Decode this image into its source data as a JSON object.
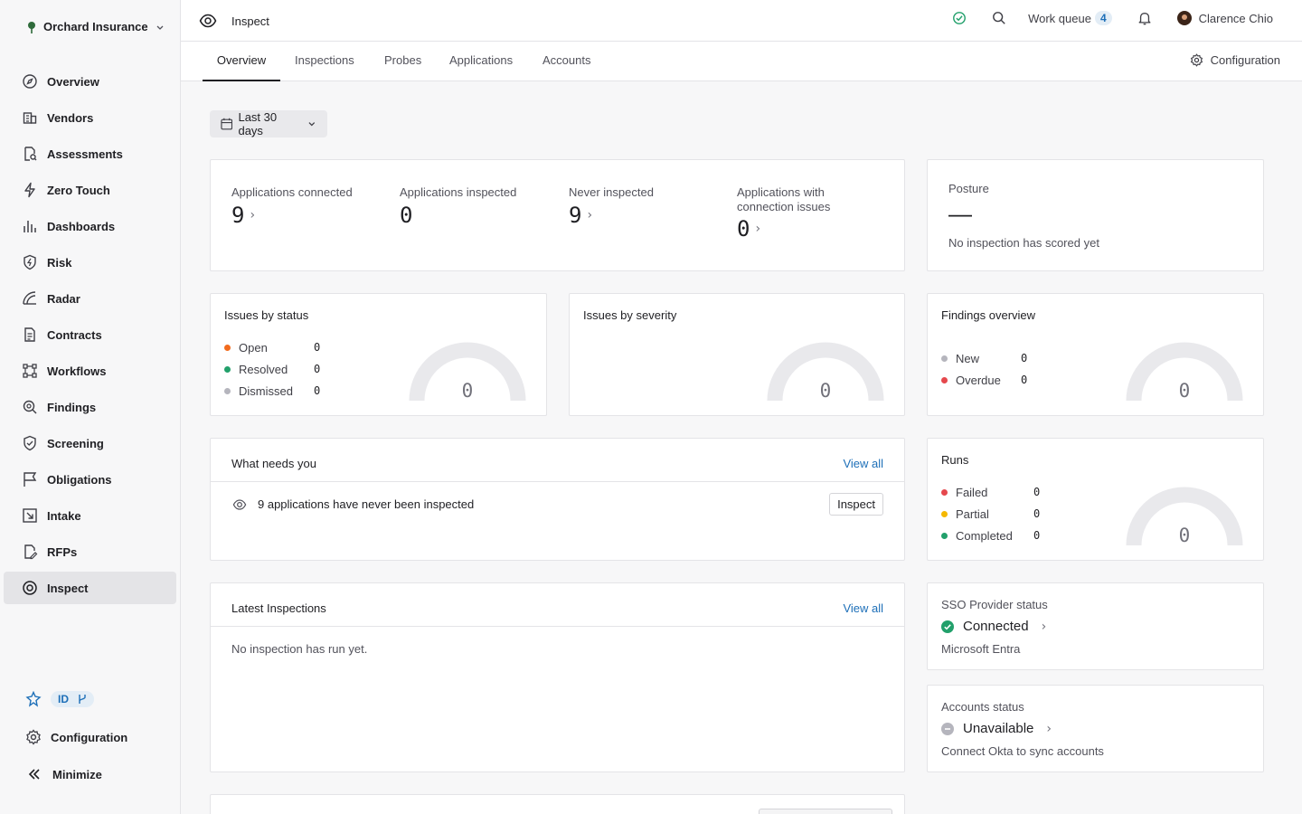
{
  "sidebar": {
    "org_name": "Orchard Insurance",
    "items": [
      {
        "label": "Overview",
        "icon": "compass-icon"
      },
      {
        "label": "Vendors",
        "icon": "building-icon"
      },
      {
        "label": "Assessments",
        "icon": "file-search-icon"
      },
      {
        "label": "Zero Touch",
        "icon": "bolt-icon"
      },
      {
        "label": "Dashboards",
        "icon": "bar-chart-icon"
      },
      {
        "label": "Risk",
        "icon": "shield-bolt-icon"
      },
      {
        "label": "Radar",
        "icon": "radar-icon"
      },
      {
        "label": "Contracts",
        "icon": "document-icon"
      },
      {
        "label": "Workflows",
        "icon": "workflow-icon"
      },
      {
        "label": "Findings",
        "icon": "magnifier-icon"
      },
      {
        "label": "Screening",
        "icon": "shield-check-icon"
      },
      {
        "label": "Obligations",
        "icon": "flag-icon"
      },
      {
        "label": "Intake",
        "icon": "arrow-in-icon"
      },
      {
        "label": "RFPs",
        "icon": "file-edit-icon"
      },
      {
        "label": "Inspect",
        "icon": "eye-icon",
        "active": true
      }
    ],
    "id_badge": "ID",
    "configuration_label": "Configuration",
    "minimize_label": "Minimize"
  },
  "header": {
    "title": "Inspect",
    "work_queue_label": "Work queue",
    "work_queue_count": "4",
    "user_name": "Clarence Chio"
  },
  "tabs": [
    "Overview",
    "Inspections",
    "Probes",
    "Applications",
    "Accounts"
  ],
  "tab_configuration_label": "Configuration",
  "date_range": "Last 30 days",
  "stats": [
    {
      "label": "Applications connected",
      "value": "9"
    },
    {
      "label": "Applications inspected",
      "value": "0"
    },
    {
      "label": "Never inspected",
      "value": "9"
    },
    {
      "label": "Applications with connection issues",
      "value": "0"
    }
  ],
  "posture": {
    "title": "Posture",
    "value": "—",
    "note": "No inspection has scored yet"
  },
  "issues_status": {
    "title": "Issues by status",
    "rows": [
      {
        "label": "Open",
        "value": "0",
        "color": "#f26b1d"
      },
      {
        "label": "Resolved",
        "value": "0",
        "color": "#22a06b"
      },
      {
        "label": "Dismissed",
        "value": "0",
        "color": "#b5b5bd"
      }
    ],
    "total": "0"
  },
  "issues_severity": {
    "title": "Issues by severity",
    "total": "0"
  },
  "findings": {
    "title": "Findings overview",
    "rows": [
      {
        "label": "New",
        "value": "0",
        "color": "#b5b5bd"
      },
      {
        "label": "Overdue",
        "value": "0",
        "color": "#e5484d"
      }
    ],
    "total": "0"
  },
  "needs": {
    "title": "What needs you",
    "view_all": "View all",
    "item_text": "9 applications have never been inspected",
    "action_label": "Inspect"
  },
  "runs": {
    "title": "Runs",
    "rows": [
      {
        "label": "Failed",
        "value": "0",
        "color": "#e5484d"
      },
      {
        "label": "Partial",
        "value": "0",
        "color": "#f5b800"
      },
      {
        "label": "Completed",
        "value": "0",
        "color": "#22a06b"
      }
    ],
    "total": "0"
  },
  "latest": {
    "title": "Latest Inspections",
    "view_all": "View all",
    "empty": "No inspection has run yet."
  },
  "sso": {
    "title": "SSO Provider status",
    "status": "Connected",
    "provider": "Microsoft Entra",
    "color": "#22a06b"
  },
  "accounts": {
    "title": "Accounts status",
    "status": "Unavailable",
    "note": "Connect Okta to sync accounts",
    "color": "#b5b5bd"
  }
}
